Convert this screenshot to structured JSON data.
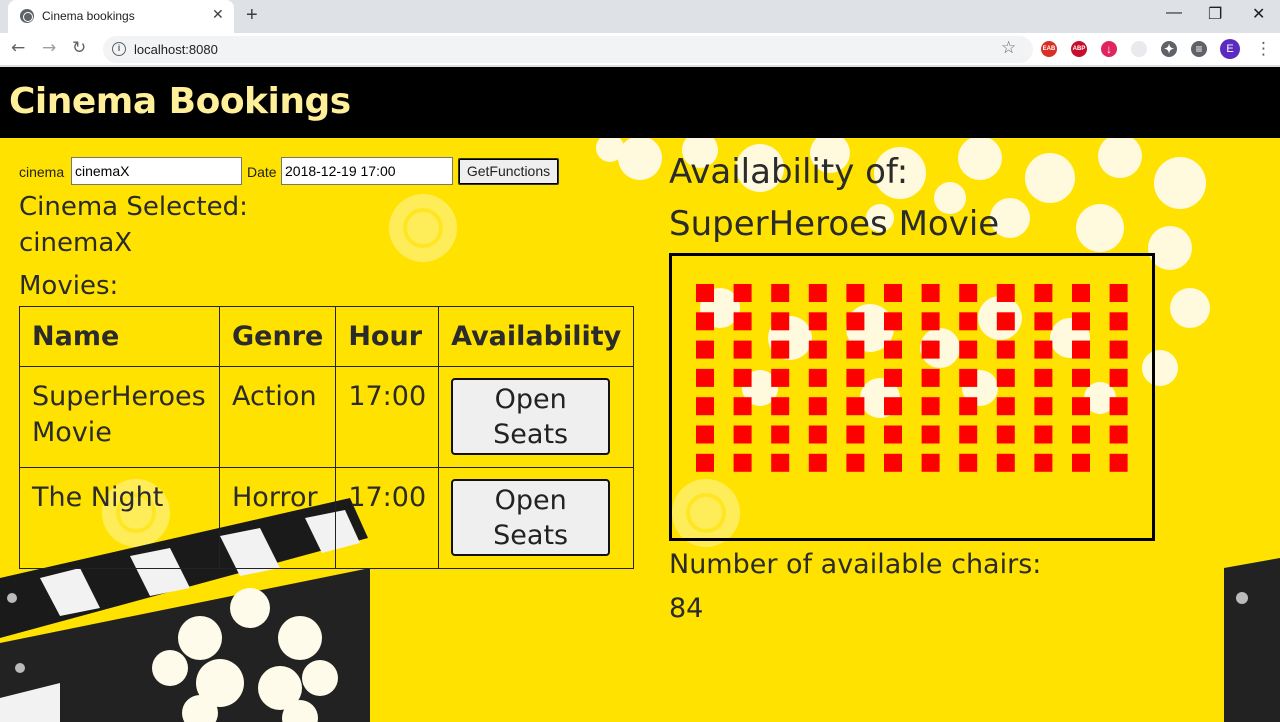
{
  "browser": {
    "tab_title": "Cinema bookings",
    "tab_close": "✕",
    "new_tab": "+",
    "url": "localhost:8080",
    "info": "i",
    "minimize": "—",
    "restore": "❐",
    "close": "✕",
    "back": "←",
    "forward": "→",
    "reload": "↻",
    "star": "☆",
    "extensions": [
      {
        "name": "eab-extension-icon",
        "text": "EAB",
        "color": "#d93025"
      },
      {
        "name": "adblock-plus-icon",
        "text": "ABP",
        "color": "#c70d2c"
      },
      {
        "name": "download-extension-icon",
        "text": "↓",
        "color": "#e0245e"
      },
      {
        "name": "blank-extension-icon",
        "text": "",
        "color": "#e8eaed"
      },
      {
        "name": "puzzle-extensions-icon",
        "text": "✦",
        "color": "#5f6368"
      },
      {
        "name": "media-queue-icon",
        "text": "≡",
        "color": "#5f6368"
      }
    ],
    "avatar": "E",
    "menu": "⋮"
  },
  "header": {
    "title": "Cinema Bookings"
  },
  "form": {
    "cinema_label": "cinema",
    "cinema_value": "cinemaX",
    "date_label": "Date",
    "date_value": "2018-12-19 17:00",
    "get_button": "GetFunctions"
  },
  "selected": {
    "heading": "Cinema Selected:",
    "cinema": "cinemaX",
    "movies_heading": "Movies:"
  },
  "table": {
    "headers": [
      "Name",
      "Genre",
      "Hour",
      "Availability"
    ],
    "rows": [
      {
        "name": "SuperHeroes Movie",
        "genre": "Action",
        "hour": "17:00",
        "button": "Open Seats"
      },
      {
        "name": "The Night",
        "genre": "Horror",
        "hour": "17:00",
        "button": "Open Seats"
      }
    ]
  },
  "availability": {
    "heading": "Availability of:",
    "movie": "SuperHeroes Movie",
    "rows": 7,
    "cols": 12,
    "seat_color": "#ff0000",
    "count_label": "Number of available chairs:",
    "count": "84"
  },
  "colors": {
    "page_bg": "#ffe200",
    "header_bg": "#000000",
    "header_text": "#ffef99"
  }
}
